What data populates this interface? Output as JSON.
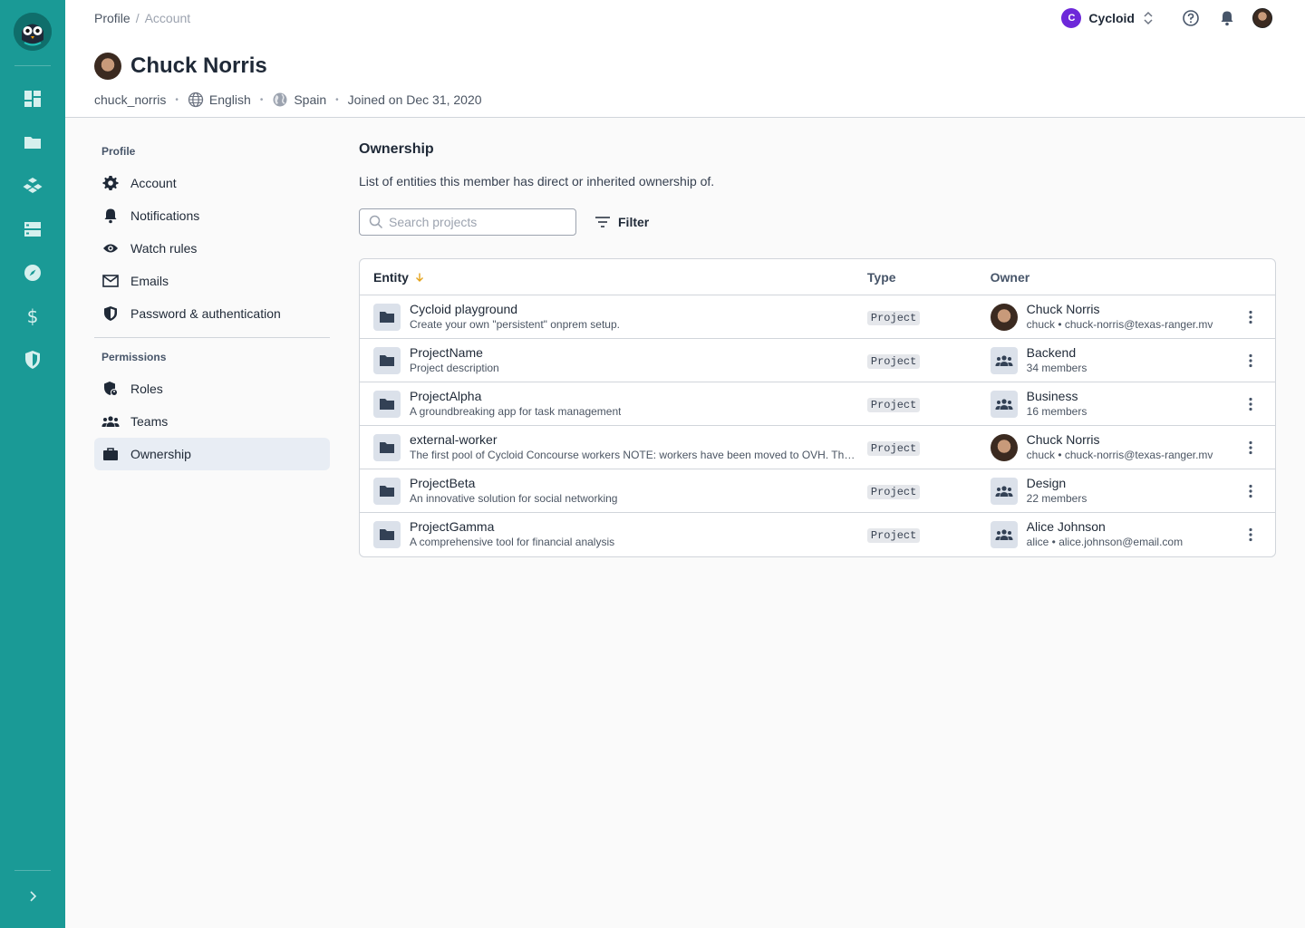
{
  "breadcrumb": {
    "parent": "Profile",
    "separator": "/",
    "current": "Account"
  },
  "org_switcher": {
    "initial": "C",
    "name": "Cycloid",
    "badge_color": "#6d28d9"
  },
  "profile": {
    "name": "Chuck Norris",
    "username": "chuck_norris",
    "language": "English",
    "country": "Spain",
    "joined": "Joined on Dec 31, 2020"
  },
  "rail": {
    "color": "#1a9a96",
    "icons": [
      "dashboard-icon",
      "folder-icon",
      "components-icon",
      "infrastructure-icon",
      "compass-icon",
      "dollar-icon",
      "shield-icon"
    ]
  },
  "sidenav": {
    "profile_section": "Profile",
    "profile_items": [
      {
        "label": "Account",
        "icon": "gear-icon"
      },
      {
        "label": "Notifications",
        "icon": "bell-icon"
      },
      {
        "label": "Watch rules",
        "icon": "eye-icon"
      },
      {
        "label": "Emails",
        "icon": "mail-icon"
      },
      {
        "label": "Password & authentication",
        "icon": "shield-icon"
      }
    ],
    "permissions_section": "Permissions",
    "permission_items": [
      {
        "label": "Roles",
        "icon": "roles-icon"
      },
      {
        "label": "Teams",
        "icon": "teams-icon"
      },
      {
        "label": "Ownership",
        "icon": "briefcase-icon",
        "active": true
      }
    ]
  },
  "main": {
    "title": "Ownership",
    "description": "List of entities this member has direct or inherited ownership of.",
    "search_placeholder": "Search projects",
    "filter_label": "Filter"
  },
  "table": {
    "columns": {
      "entity": "Entity",
      "type": "Type",
      "owner": "Owner"
    },
    "rows": [
      {
        "name": "Cycloid playground",
        "description": "Create your own \"persistent\" onprem setup.",
        "type": "Project",
        "owner_kind": "person",
        "owner_name": "Chuck Norris",
        "owner_sub": "chuck • chuck-norris@texas-ranger.mv"
      },
      {
        "name": "ProjectName",
        "description": "Project description",
        "type": "Project",
        "owner_kind": "team",
        "owner_name": "Backend",
        "owner_sub": "34 members"
      },
      {
        "name": "ProjectAlpha",
        "description": "A groundbreaking app for task management",
        "type": "Project",
        "owner_kind": "team",
        "owner_name": "Business",
        "owner_sub": "16 members"
      },
      {
        "name": "external-worker",
        "description": "The first pool of Cycloid Concourse workers NOTE: workers have been moved to OVH. This…",
        "type": "Project",
        "owner_kind": "person",
        "owner_name": "Chuck Norris",
        "owner_sub": "chuck • chuck-norris@texas-ranger.mv"
      },
      {
        "name": "ProjectBeta",
        "description": "An innovative solution for social networking",
        "type": "Project",
        "owner_kind": "team",
        "owner_name": "Design",
        "owner_sub": "22 members"
      },
      {
        "name": "ProjectGamma",
        "description": "A comprehensive tool for financial analysis",
        "type": "Project",
        "owner_kind": "team",
        "owner_name": "Alice Johnson",
        "owner_sub": "alice • alice.johnson@email.com"
      }
    ]
  }
}
